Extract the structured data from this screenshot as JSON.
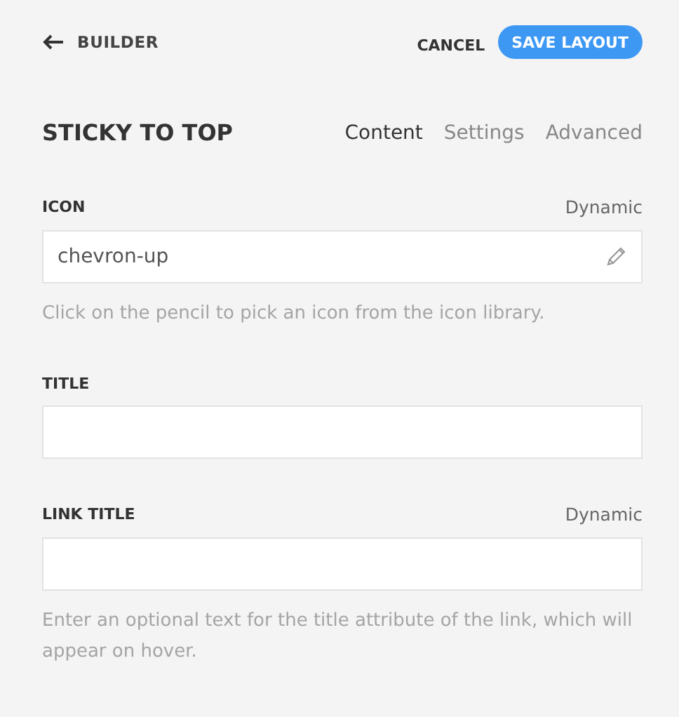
{
  "header": {
    "back": "BUILDER",
    "cancel": "CANCEL",
    "save": "SAVE LAYOUT"
  },
  "panel": {
    "title": "STICKY TO TOP",
    "tabs": [
      {
        "label": "Content",
        "selected": true
      },
      {
        "label": "Settings",
        "selected": false
      },
      {
        "label": "Advanced",
        "selected": false
      }
    ]
  },
  "fields": [
    {
      "label": "ICON",
      "dynamic": "Dynamic",
      "value": "chevron-up",
      "kind": "icon",
      "help": "Click on the pencil to pick an icon from the icon library."
    },
    {
      "label": "TITLE",
      "kind": "text"
    },
    {
      "label": "LINK TITLE",
      "dynamic": "Dynamic",
      "kind": "text",
      "help": "Enter an optional text for the title attribute of the link, which will appear on hover."
    }
  ]
}
